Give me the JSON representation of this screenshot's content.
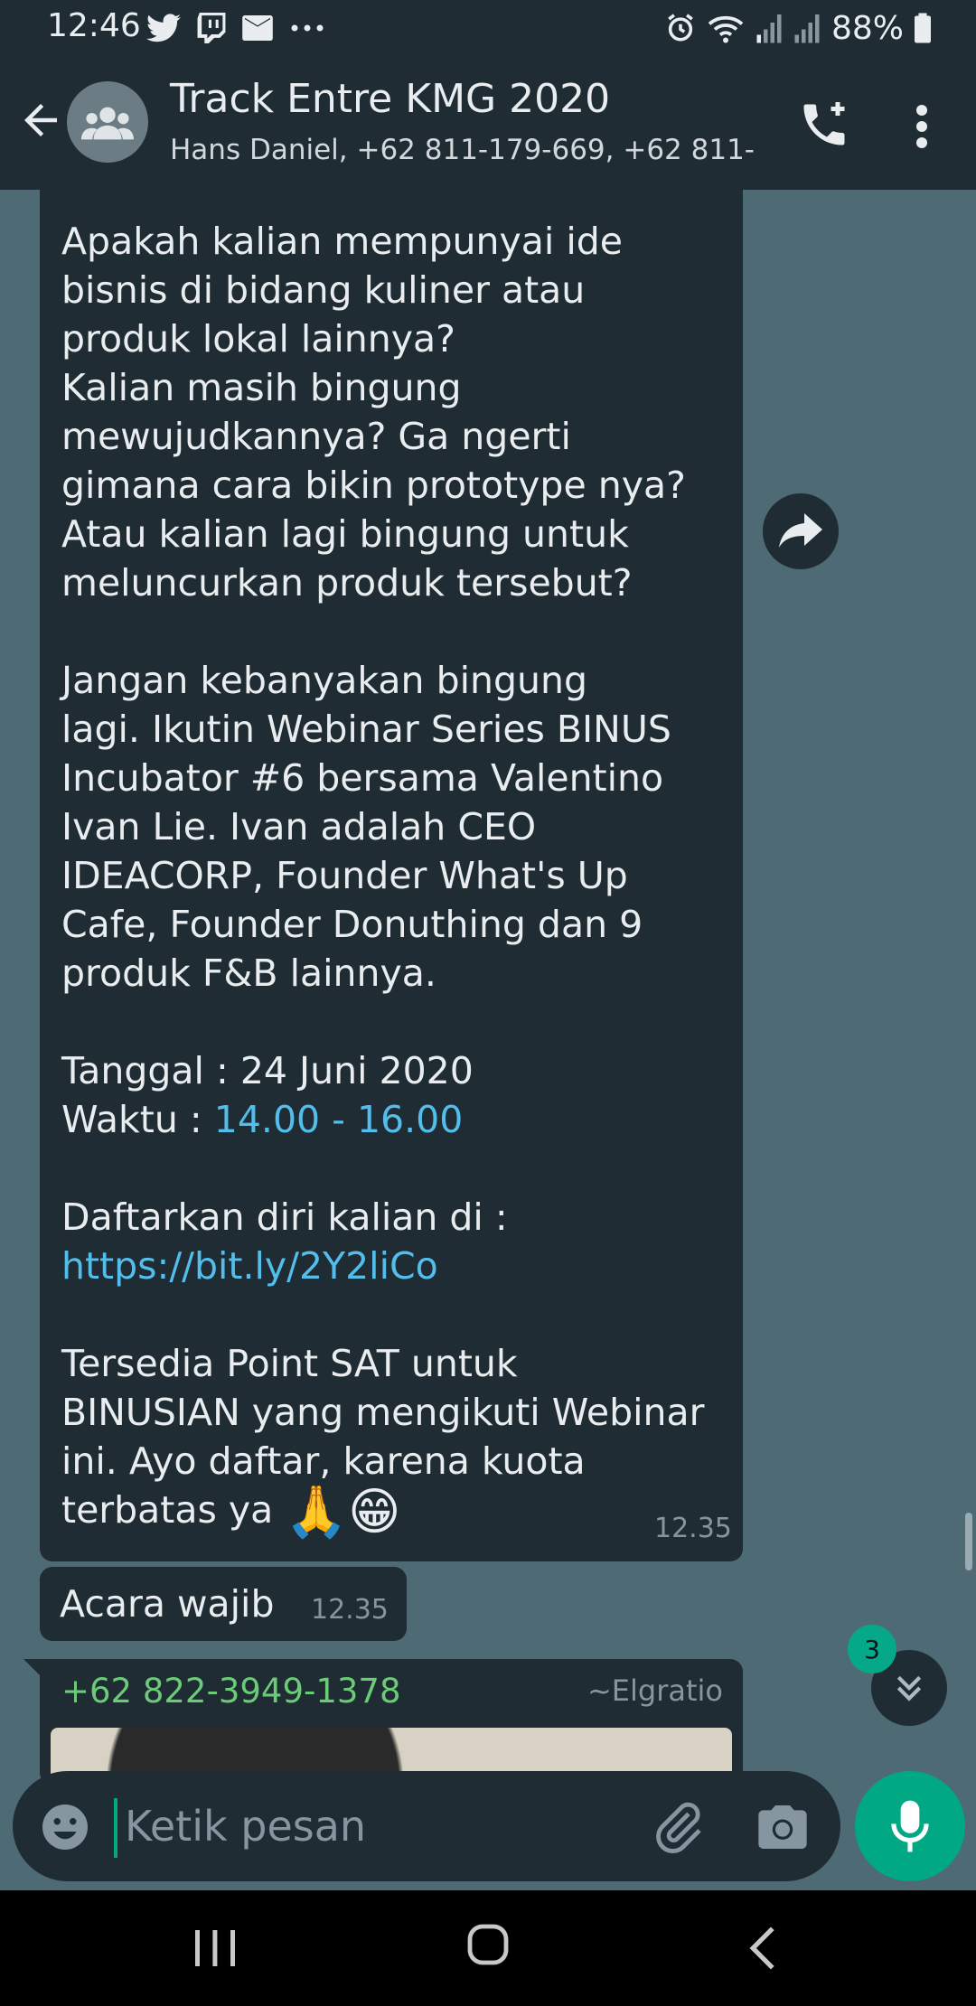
{
  "status_bar": {
    "time": "12:46",
    "battery": "88%",
    "icons_left": [
      "twitter-icon",
      "twitch-icon",
      "mail-icon",
      "more-dots-icon"
    ],
    "icons_right": [
      "alarm-icon",
      "wifi-icon",
      "signal-icon",
      "signal-icon",
      "battery-icon"
    ]
  },
  "header": {
    "title": "Track Entre KMG 2020",
    "subtitle": "Hans Daniel, +62 811-179-669, +62 811-..."
  },
  "messages": {
    "main": {
      "part1": "Apakah kalian mempunyai ide\nbisnis di bidang kuliner atau\nproduk lokal lainnya?\nKalian masih bingung\nmewujudkannya? Ga ngerti\ngimana cara bikin prototype nya?\nAtau kalian lagi bingung untuk\nmeluncurkan produk tersebut?\n\nJangan kebanyakan bingung\nlagi. Ikutin Webinar Series BINUS\nIncubator #6 bersama Valentino\nIvan Lie. Ivan adalah CEO\nIDEACORP, Founder What's Up\nCafe, Founder Donuthing dan 9\nproduk F&B lainnya.\n\nTanggal : 24 Juni 2020\nWaktu : ",
      "time_link": "14.00 - 16.00",
      "part2": "\n\nDaftarkan diri kalian di :\n",
      "url": "https://bit.ly/2Y2liCo",
      "part3": "\n\nTersedia Point SAT untuk\nBINUSIAN yang mengikuti Webinar\nini. Ayo daftar, karena kuota\nterbatas ya ",
      "emoji1": "🙏",
      "emoji2": "😁",
      "timestamp": "12.35"
    },
    "small": {
      "text": "Acara wajib",
      "timestamp": "12.35"
    },
    "reply": {
      "sender_phone": "+62 822-3949-1378",
      "sender_name": "~Elgratio"
    }
  },
  "unread_count": "3",
  "input": {
    "placeholder": "Ketik pesan",
    "value": ""
  },
  "colors": {
    "header_bg": "#1f2c34",
    "chat_bg": "#4e6a75",
    "bubble_bg": "#1f2c33",
    "accent": "#00a884",
    "link": "#53bdeb",
    "sender": "#6bcb77"
  }
}
